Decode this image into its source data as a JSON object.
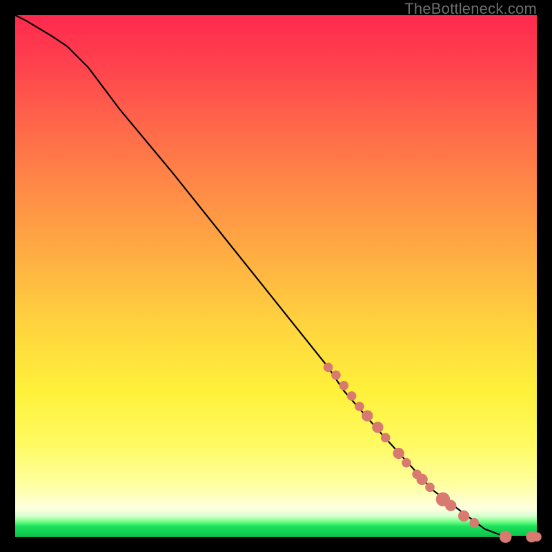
{
  "attribution": "TheBottleneck.com",
  "colors": {
    "border": "#000000",
    "curve": "#000000",
    "marker": "#d87a6f"
  },
  "chart_data": {
    "type": "line",
    "title": "",
    "xlabel": "",
    "ylabel": "",
    "xlim": [
      0,
      100
    ],
    "ylim": [
      0,
      100
    ],
    "grid": false,
    "series": [
      {
        "name": "curve",
        "x": [
          0,
          1,
          2,
          4,
          7,
          10,
          14,
          20,
          30,
          40,
          50,
          60,
          63,
          70,
          80,
          90,
          94,
          99,
          100
        ],
        "y": [
          100,
          99.5,
          99,
          97.8,
          96,
          94,
          90,
          82,
          70,
          57.5,
          45,
          32.5,
          28,
          20,
          9,
          1.5,
          0,
          0,
          0
        ]
      }
    ],
    "markers": [
      {
        "x": 60,
        "y": 32.5,
        "r": 1.0
      },
      {
        "x": 61.5,
        "y": 31.0,
        "r": 1.0
      },
      {
        "x": 63,
        "y": 29.0,
        "r": 1.0
      },
      {
        "x": 64.5,
        "y": 27.0,
        "r": 1.0
      },
      {
        "x": 66,
        "y": 25.0,
        "r": 1.0
      },
      {
        "x": 67.5,
        "y": 23.2,
        "r": 1.2
      },
      {
        "x": 69.5,
        "y": 21.0,
        "r": 1.2
      },
      {
        "x": 71,
        "y": 19.0,
        "r": 1.0
      },
      {
        "x": 73.5,
        "y": 16.0,
        "r": 1.2
      },
      {
        "x": 75,
        "y": 14.2,
        "r": 1.0
      },
      {
        "x": 77,
        "y": 12.0,
        "r": 1.0
      },
      {
        "x": 78,
        "y": 11.0,
        "r": 1.2
      },
      {
        "x": 79.5,
        "y": 9.5,
        "r": 1.0
      },
      {
        "x": 82,
        "y": 7.2,
        "r": 1.5
      },
      {
        "x": 83.5,
        "y": 6.0,
        "r": 1.2
      },
      {
        "x": 86,
        "y": 4.0,
        "r": 1.2
      },
      {
        "x": 88,
        "y": 2.7,
        "r": 1.0
      },
      {
        "x": 94,
        "y": 0.0,
        "r": 1.3
      },
      {
        "x": 99,
        "y": 0.0,
        "r": 1.2
      },
      {
        "x": 100,
        "y": 0.0,
        "r": 1.0
      }
    ]
  }
}
